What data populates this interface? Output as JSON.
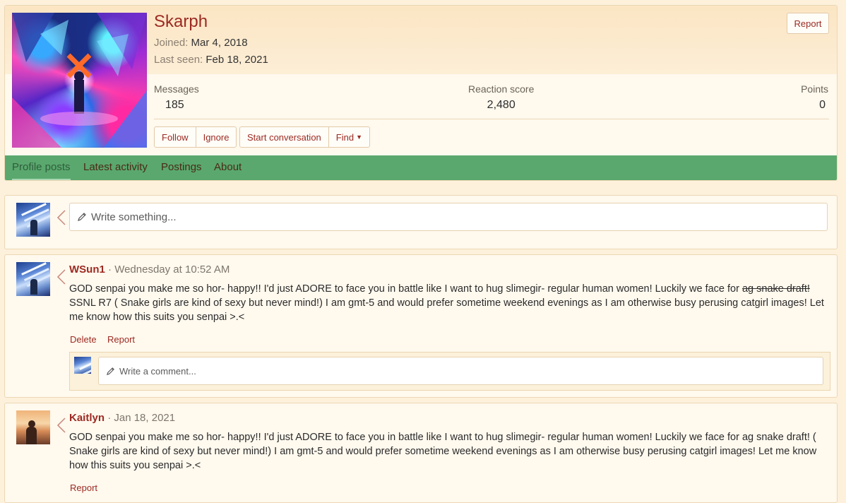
{
  "profile": {
    "username": "Skarph",
    "joined_label": "Joined:",
    "joined_value": "Mar 4, 2018",
    "last_seen_label": "Last seen:",
    "last_seen_value": "Feb 18, 2021",
    "report_label": "Report",
    "stats": {
      "messages_label": "Messages",
      "messages_value": "185",
      "reaction_label": "Reaction score",
      "reaction_value": "2,480",
      "points_label": "Points",
      "points_value": "0"
    },
    "buttons": {
      "follow": "Follow",
      "ignore": "Ignore",
      "start_conversation": "Start conversation",
      "find": "Find"
    }
  },
  "tabs": [
    "Profile posts",
    "Latest activity",
    "Postings",
    "About"
  ],
  "write_box": {
    "placeholder": "Write something..."
  },
  "posts": [
    {
      "author": "WSun1",
      "separator": "·",
      "time": "Wednesday at 10:52 AM",
      "body_before_strike": "GOD senpai you make me so hor- happy!! I'd just ADORE to face you in battle like I want to hug slimegir- regular human women! Luckily we face for ",
      "body_strike": "ag snake draft!",
      "body_after_strike": " SSNL R7 ( Snake girls are kind of sexy but never mind!) I am gmt-5 and would prefer sometime weekend evenings as I am otherwise busy perusing catgirl images! Let me know how this suits you senpai >.<",
      "actions": {
        "delete": "Delete",
        "report": "Report"
      },
      "comment_placeholder": "Write a comment..."
    },
    {
      "author": "Kaitlyn",
      "separator": "·",
      "time": "Jan 18, 2021",
      "body": "GOD senpai you make me so hor- happy!! I'd just ADORE to face you in battle like I want to hug slimegir- regular human women! Luckily we face for ag snake draft! ( Snake girls are kind of sexy but never mind!) I am gmt-5 and would prefer sometime weekend evenings as I am otherwise busy perusing catgirl images! Let me know how this suits you senpai >.<",
      "actions": {
        "report": "Report"
      }
    }
  ]
}
